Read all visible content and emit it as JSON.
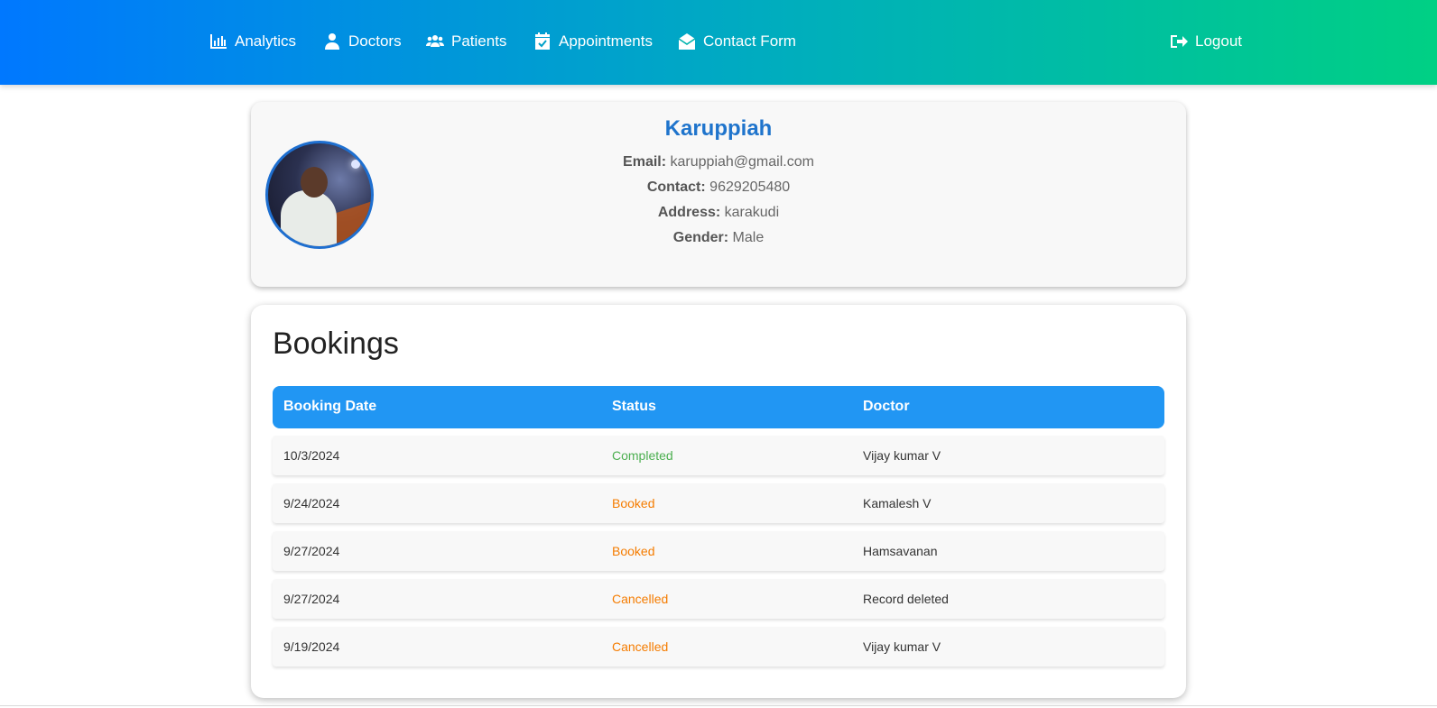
{
  "nav": {
    "items": [
      {
        "label": "Analytics",
        "icon": "bar-chart-icon"
      },
      {
        "label": "Doctors",
        "icon": "doctor-icon"
      },
      {
        "label": "Patients",
        "icon": "users-icon"
      },
      {
        "label": "Appointments",
        "icon": "calendar-check-icon"
      },
      {
        "label": "Contact Form",
        "icon": "envelope-open-icon"
      }
    ],
    "logout": {
      "label": "Logout",
      "icon": "logout-icon"
    }
  },
  "profile": {
    "name": "Karuppiah",
    "email_label": "Email:",
    "email": "karuppiah@gmail.com",
    "contact_label": "Contact:",
    "contact": "9629205480",
    "address_label": "Address:",
    "address": "karakudi",
    "gender_label": "Gender:",
    "gender": "Male"
  },
  "bookings": {
    "title": "Bookings",
    "columns": [
      "Booking Date",
      "Status",
      "Doctor"
    ],
    "rows": [
      {
        "date": "10/3/2024",
        "status": "Completed",
        "doctor": "Vijay kumar V"
      },
      {
        "date": "9/24/2024",
        "status": "Booked",
        "doctor": "Kamalesh V"
      },
      {
        "date": "9/27/2024",
        "status": "Booked",
        "doctor": "Hamsavanan"
      },
      {
        "date": "9/27/2024",
        "status": "Cancelled",
        "doctor": "Record deleted"
      },
      {
        "date": "9/19/2024",
        "status": "Cancelled",
        "doctor": "Vijay kumar V"
      }
    ]
  },
  "colors": {
    "accent": "#2196f3",
    "name": "#1f74cc",
    "completed": "#4caf50",
    "booked": "#f57c00",
    "cancelled": "#f57c00"
  }
}
